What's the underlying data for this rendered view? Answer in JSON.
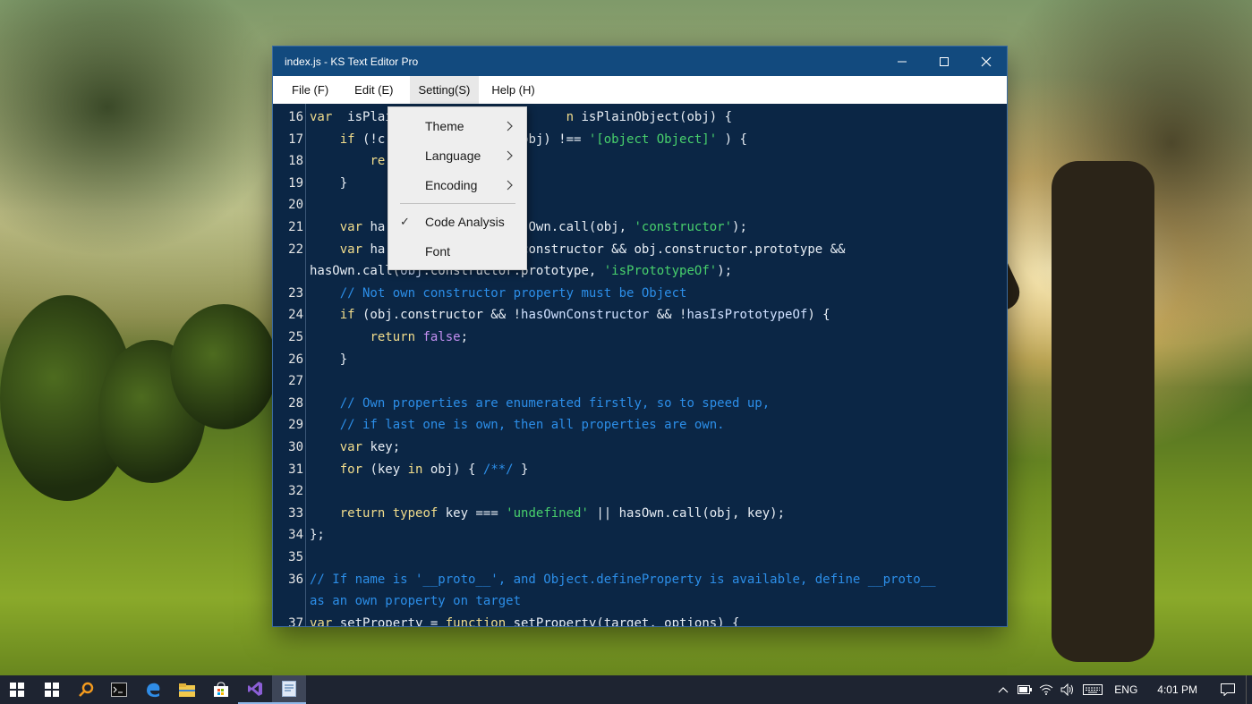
{
  "window": {
    "title": "index.js - KS Text Editor Pro"
  },
  "menubar": {
    "items": [
      "File (F)",
      "Edit (E)",
      "Setting(S)",
      "Help (H)"
    ]
  },
  "settings_menu": {
    "items": [
      {
        "label": "Theme",
        "submenu": true,
        "checked": false
      },
      {
        "label": "Language",
        "submenu": true,
        "checked": false
      },
      {
        "label": "Encoding",
        "submenu": true,
        "checked": false
      },
      {
        "label": "Code Analysis",
        "submenu": false,
        "checked": true
      },
      {
        "label": "Font",
        "submenu": false,
        "checked": false
      }
    ],
    "check_glyph": "✓",
    "arrow_glyph": ">"
  },
  "editor": {
    "lines": [
      {
        "n": "16",
        "tokens": [
          [
            "kw",
            "var"
          ],
          [
            "",
            "  isPlai"
          ],
          [
            "",
            "                       "
          ],
          [
            "kw",
            "n"
          ],
          [
            "",
            " isPlainObject(obj) {"
          ]
        ]
      },
      {
        "n": "17",
        "tokens": [
          [
            "",
            "    "
          ],
          [
            "kw",
            "if"
          ],
          [
            "",
            " (!c"
          ],
          [
            "",
            "                  obj) !== "
          ],
          [
            "str",
            "'[object Object]'"
          ],
          [
            "",
            " ) {"
          ]
        ]
      },
      {
        "n": "18",
        "tokens": [
          [
            "",
            "        "
          ],
          [
            "kw",
            "re"
          ]
        ]
      },
      {
        "n": "19",
        "tokens": [
          [
            "",
            "    }"
          ]
        ]
      },
      {
        "n": "20",
        "tokens": [
          [
            "",
            ""
          ]
        ]
      },
      {
        "n": "21",
        "tokens": [
          [
            "",
            "    "
          ],
          [
            "kw",
            "var"
          ],
          [
            "",
            " ha"
          ],
          [
            "",
            "              = hasOwn.call(obj, "
          ],
          [
            "str",
            "'constructor'"
          ],
          [
            "",
            ");"
          ]
        ]
      },
      {
        "n": "22",
        "tokens": [
          [
            "",
            "    "
          ],
          [
            "kw",
            "var"
          ],
          [
            "",
            " ha"
          ],
          [
            "",
            "              obj.constructor && obj.constructor.prototype &&"
          ]
        ]
      },
      {
        "n": "",
        "tokens": [
          [
            "",
            "hasOwn.call("
          ],
          [
            "id",
            "obj"
          ],
          [
            "",
            ".constructor.prototype, "
          ],
          [
            "str",
            "'isPrototypeOf'"
          ],
          [
            "",
            ");"
          ]
        ]
      },
      {
        "n": "23",
        "tokens": [
          [
            "",
            "    "
          ],
          [
            "cm",
            "// Not own constructor property must be Object"
          ]
        ]
      },
      {
        "n": "24",
        "tokens": [
          [
            "",
            "    "
          ],
          [
            "kw",
            "if"
          ],
          [
            "",
            " (obj.constructor && !"
          ],
          [
            "id",
            "hasOwnConstructor"
          ],
          [
            "",
            " && !"
          ],
          [
            "id",
            "hasIsPrototypeOf"
          ],
          [
            "",
            ") {"
          ]
        ]
      },
      {
        "n": "25",
        "tokens": [
          [
            "",
            "        "
          ],
          [
            "kw",
            "return"
          ],
          [
            "",
            " "
          ],
          [
            "fl",
            "false"
          ],
          [
            "",
            ";"
          ]
        ]
      },
      {
        "n": "26",
        "tokens": [
          [
            "",
            "    }"
          ]
        ]
      },
      {
        "n": "27",
        "tokens": [
          [
            "",
            ""
          ]
        ]
      },
      {
        "n": "28",
        "tokens": [
          [
            "",
            "    "
          ],
          [
            "cm",
            "// Own properties are enumerated firstly, so to speed up,"
          ]
        ]
      },
      {
        "n": "29",
        "tokens": [
          [
            "",
            "    "
          ],
          [
            "cm",
            "// if last one is own, then all properties are own."
          ]
        ]
      },
      {
        "n": "30",
        "tokens": [
          [
            "",
            "    "
          ],
          [
            "kw",
            "var"
          ],
          [
            "",
            " key;"
          ]
        ]
      },
      {
        "n": "31",
        "tokens": [
          [
            "",
            "    "
          ],
          [
            "kw",
            "for"
          ],
          [
            "",
            " (key "
          ],
          [
            "kw",
            "in"
          ],
          [
            "",
            " obj) { "
          ],
          [
            "cm",
            "/**/"
          ],
          [
            "",
            " }"
          ]
        ]
      },
      {
        "n": "32",
        "tokens": [
          [
            "",
            ""
          ]
        ]
      },
      {
        "n": "33",
        "tokens": [
          [
            "",
            "    "
          ],
          [
            "kw",
            "return"
          ],
          [
            "",
            " "
          ],
          [
            "kw",
            "typeof"
          ],
          [
            "",
            " key === "
          ],
          [
            "str",
            "'undefined'"
          ],
          [
            "",
            " || hasOwn.call(obj, key);"
          ]
        ]
      },
      {
        "n": "34",
        "tokens": [
          [
            "",
            "};"
          ]
        ]
      },
      {
        "n": "35",
        "tokens": [
          [
            "",
            ""
          ]
        ]
      },
      {
        "n": "36",
        "tokens": [
          [
            "cm",
            "// If name is '__proto__', and Object.defineProperty is available, define __proto__"
          ]
        ]
      },
      {
        "n": "",
        "tokens": [
          [
            "cm",
            "as an own property on target"
          ]
        ]
      },
      {
        "n": "37",
        "tokens": [
          [
            "kw",
            "var"
          ],
          [
            "",
            " setProperty = "
          ],
          [
            "kw",
            "function"
          ],
          [
            "",
            " setProperty(target, options) {"
          ]
        ]
      }
    ]
  },
  "taskbar": {
    "icons": [
      "windows-start-icon",
      "task-view-icon",
      "search-icon",
      "terminal-icon",
      "edge-icon",
      "file-explorer-icon",
      "store-icon",
      "visual-studio-icon",
      "text-editor-icon"
    ],
    "tray": {
      "language": "ENG",
      "time": "4:01 PM"
    }
  },
  "colors": {
    "titlebar": "#124a7e",
    "editor_bg": "#0b2645",
    "keyword": "#f2dd8c",
    "string": "#48d06c",
    "comment": "#2c8ee8"
  }
}
